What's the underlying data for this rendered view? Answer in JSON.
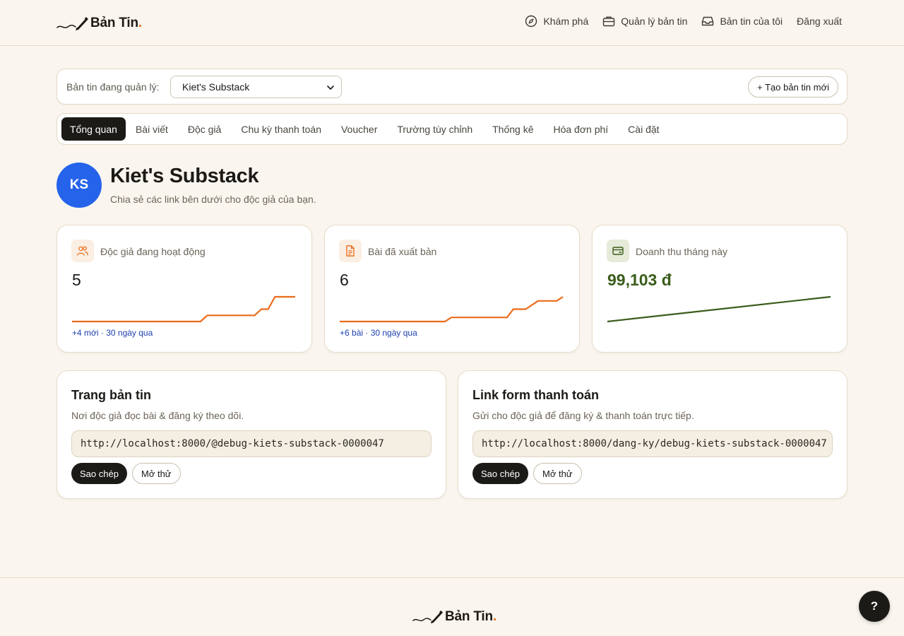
{
  "brand": {
    "name": "Bản Tin",
    "dot": ".",
    "accent": "#ea6b1a"
  },
  "nav": {
    "items": [
      {
        "label": "Khám phá",
        "icon": "compass-icon"
      },
      {
        "label": "Quản lý bản tin",
        "icon": "briefcase-icon"
      },
      {
        "label": "Bản tin của tôi",
        "icon": "inbox-icon"
      },
      {
        "label": "Đăng xuất",
        "icon": ""
      }
    ]
  },
  "selector": {
    "label": "Bản tin đang quản lý:",
    "selected": "Kiet's Substack",
    "new_button": "+ Tạo bản tin mới"
  },
  "tabs": [
    {
      "label": "Tổng quan",
      "active": true
    },
    {
      "label": "Bài viết",
      "active": false
    },
    {
      "label": "Độc giả",
      "active": false
    },
    {
      "label": "Chu kỳ thanh toán",
      "active": false
    },
    {
      "label": "Voucher",
      "active": false
    },
    {
      "label": "Trường tùy chỉnh",
      "active": false
    },
    {
      "label": "Thống kê",
      "active": false
    },
    {
      "label": "Hóa đơn phí",
      "active": false
    },
    {
      "label": "Cài đặt",
      "active": false
    }
  ],
  "profile": {
    "initials": "KS",
    "title": "Kiet's Substack",
    "subtitle": "Chia sẻ các link bên dưới cho độc giả của bạn.",
    "avatar_color": "#2563eb"
  },
  "stats": [
    {
      "label": "Độc giả đang hoạt động",
      "value": "5",
      "note": "+4 mới · 30 ngày qua",
      "icon": "users-icon",
      "color": "#ea6b1a"
    },
    {
      "label": "Bài đã xuất bản",
      "value": "6",
      "note": "+6 bài · 30 ngày qua",
      "icon": "document-icon",
      "color": "#ea6b1a"
    },
    {
      "label": "Doanh thu tháng này",
      "value": "99,103 đ",
      "note": "",
      "icon": "wallet-icon",
      "color": "#3a5d1b"
    }
  ],
  "chart_data": [
    {
      "type": "line",
      "series": [
        {
          "values": [
            1,
            1,
            1,
            1,
            1,
            1,
            1,
            1,
            1,
            1,
            1,
            1,
            1,
            1,
            1,
            1,
            1,
            1,
            1,
            1,
            2,
            2,
            2,
            2,
            2,
            2,
            2,
            2,
            3,
            3,
            5,
            5,
            5,
            5
          ]
        }
      ]
    },
    {
      "type": "line",
      "series": [
        {
          "values": [
            0,
            0,
            0,
            0,
            0,
            0,
            0,
            0,
            0,
            0,
            0,
            0,
            0,
            0,
            0,
            0,
            0,
            0,
            1,
            1,
            1,
            1,
            1,
            1,
            1,
            1,
            1,
            1,
            3,
            3,
            3,
            4,
            5,
            5,
            5,
            5,
            6
          ]
        }
      ]
    },
    {
      "type": "line",
      "series": [
        {
          "values": [
            0,
            99103
          ]
        }
      ]
    }
  ],
  "links": [
    {
      "title": "Trang bản tin",
      "desc": "Nơi độc giả đọc bài & đăng ký theo dõi.",
      "url": "http://localhost:8000/@debug-kiets-substack-0000047",
      "copy": "Sao chép",
      "open": "Mở thử"
    },
    {
      "title": "Link form thanh toán",
      "desc": "Gửi cho độc giả để đăng ký & thanh toán trực tiếp.",
      "url": "http://localhost:8000/dang-ky/debug-kiets-substack-0000047",
      "copy": "Sao chép",
      "open": "Mở thử"
    }
  ],
  "help": {
    "label": "?"
  }
}
